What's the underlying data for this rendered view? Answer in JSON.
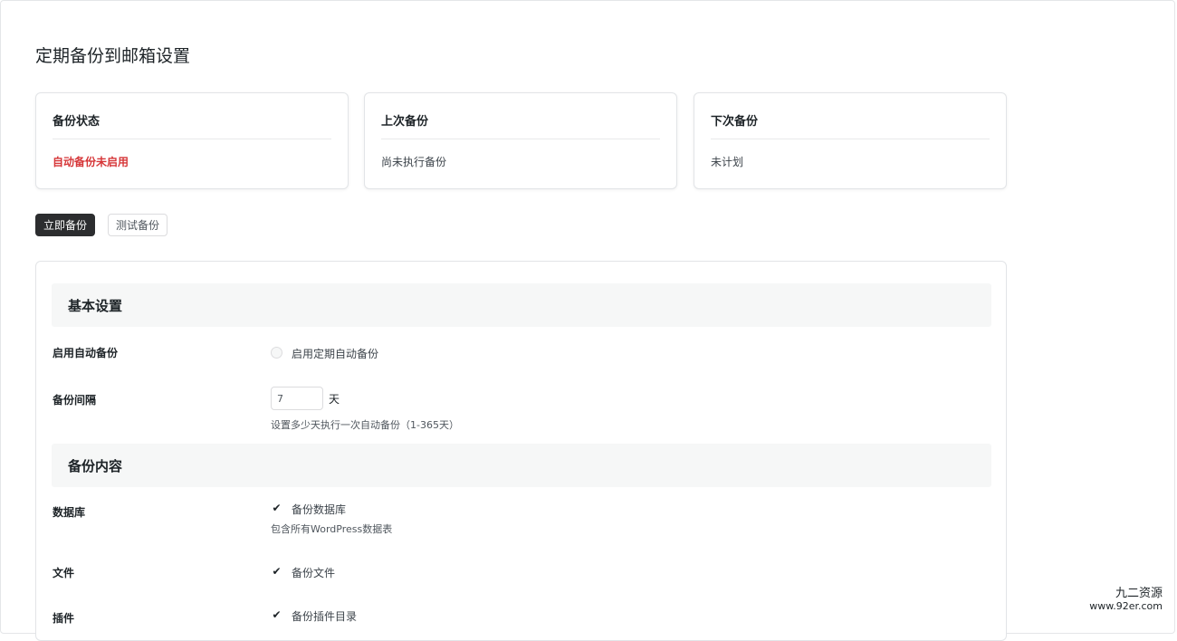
{
  "page": {
    "title": "定期备份到邮箱设置"
  },
  "status_cards": [
    {
      "title": "备份状态",
      "value": "自动备份未启用",
      "value_color": "#d63638"
    },
    {
      "title": "上次备份",
      "value": "尚未执行备份"
    },
    {
      "title": "下次备份",
      "value": "未计划"
    }
  ],
  "actions": {
    "backup_now_label": "立即备份",
    "test_backup_label": "测试备份"
  },
  "basic_settings": {
    "section_title": "基本设置",
    "auto_backup": {
      "label": "启用自动备份",
      "checkbox_label": "启用定期自动备份",
      "checked": false
    },
    "interval": {
      "label": "备份间隔",
      "value": "7",
      "unit": "天",
      "help": "设置多少天执行一次自动备份（1-365天）"
    }
  },
  "backup_content": {
    "section_title": "备份内容",
    "database": {
      "label": "数据库",
      "checkbox_label": "备份数据库",
      "checked": true,
      "help": "包含所有WordPress数据表"
    },
    "files": {
      "label": "文件",
      "checkbox_label": "备份文件",
      "checked": true
    },
    "plugins": {
      "label": "插件",
      "checkbox_label": "备份插件目录",
      "checked": true
    }
  },
  "watermark": {
    "name": "九二资源",
    "url": "www.92er.com"
  },
  "colors": {
    "primary_button": "#2c2d2f",
    "danger": "#d63638",
    "section_bg": "#f6f7f7"
  }
}
